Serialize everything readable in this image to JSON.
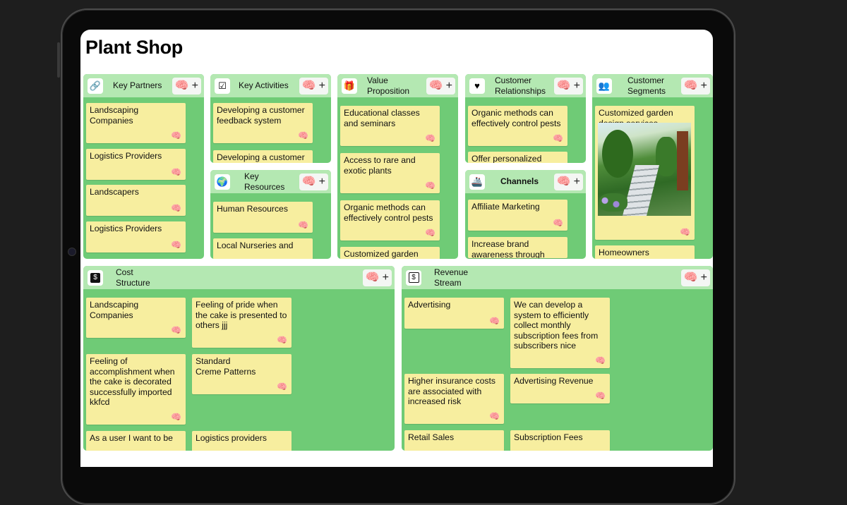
{
  "title": "Plant Shop",
  "tool_icons": {
    "ai": "brain-icon",
    "add": "plus-icon"
  },
  "colors": {
    "block": "#6fcb76",
    "header": "#b4e8b2",
    "card": "#f7ee9f"
  },
  "key_partners": {
    "label": "Key Partners",
    "icon": "link-icon",
    "cards": [
      "Landscaping Companies",
      "Logistics Providers",
      "Landscapers",
      "Logistics Providers"
    ]
  },
  "key_activities": {
    "label": "Key Activities",
    "icon": "checkbox-icon",
    "cards": [
      "Developing a customer feedback system",
      "Developing a customer"
    ]
  },
  "key_resources": {
    "label": "Key\nResources",
    "icon": "globe-icon",
    "cards": [
      "Human Resources",
      "Local Nurseries and"
    ]
  },
  "value_proposition": {
    "label": "Value\nProposition",
    "icon": "gift-icon",
    "cards": [
      "Educational classes and seminars",
      "Access to rare and exotic plants",
      "Organic methods can effectively control pests",
      "Customized garden"
    ]
  },
  "customer_relationships": {
    "label": "Customer\nRelationships",
    "icon": "heart-icon",
    "cards": [
      "Organic methods can effectively control pests",
      "Offer personalized"
    ]
  },
  "channels": {
    "label": "Channels",
    "icon": "ship-icon",
    "cards": [
      "Affiliate Marketing",
      "Increase brand awareness through"
    ]
  },
  "customer_segments": {
    "label": "Customer\nSegments",
    "icon": "people-icon",
    "cards": [
      "Customized garden design services",
      "Homeowners"
    ]
  },
  "cost_structure": {
    "label": "Cost\nStructure",
    "icon": "dollar-icon",
    "cards": [
      "Landscaping Companies",
      "Feeling of pride when the cake is presented to others jjj",
      "Feeling of accomplishment when the cake is decorated successfully imported kkfcd",
      "Standard\nCreme Patterns",
      "As a user I want to be",
      "Logistics providers"
    ]
  },
  "revenue_stream": {
    "label": "Revenue\nStream",
    "icon": "dollar-icon",
    "cards": [
      "Advertising",
      "We can develop a system to efficiently collect monthly subscription fees from subscribers nice",
      "Higher insurance costs are associated with increased risk",
      "Advertising Revenue",
      "Retail Sales",
      "Subscription Fees"
    ]
  }
}
